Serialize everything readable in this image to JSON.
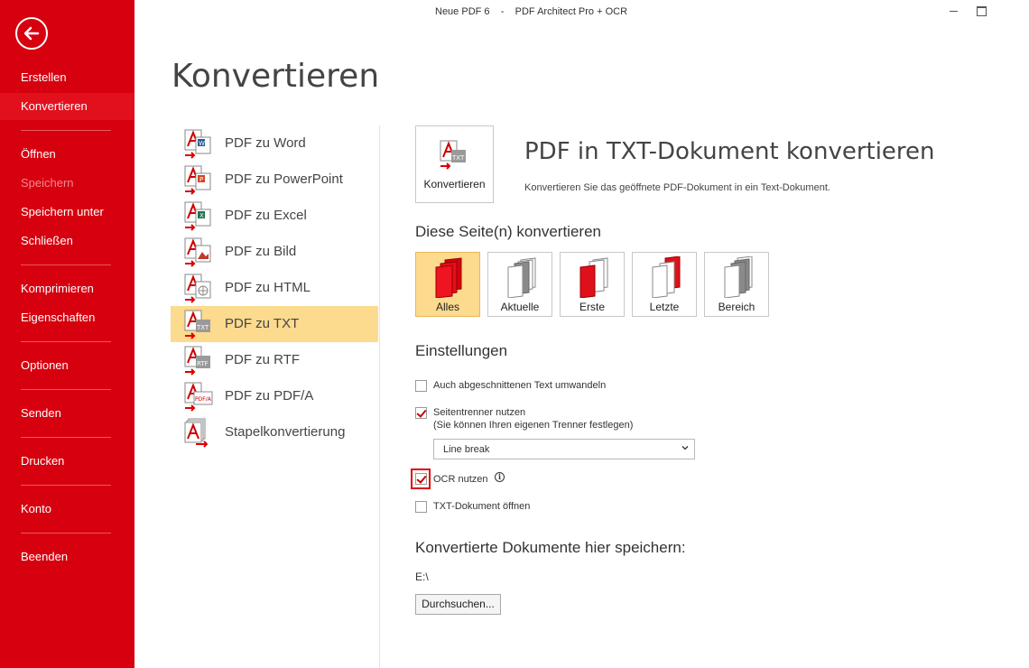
{
  "window": {
    "title": "Neue PDF 6    -    PDF Architect Pro + OCR"
  },
  "sidebar": {
    "back_icon": "arrow-left-circle-icon",
    "items": [
      {
        "label": "Erstellen"
      },
      {
        "label": "Konvertieren",
        "active": true
      },
      {
        "label": "Öffnen"
      },
      {
        "label": "Speichern",
        "disabled": true
      },
      {
        "label": "Speichern unter"
      },
      {
        "label": "Schließen"
      },
      {
        "label": "Komprimieren"
      },
      {
        "label": "Eigenschaften"
      },
      {
        "label": "Optionen"
      },
      {
        "label": "Senden"
      },
      {
        "label": "Drucken"
      },
      {
        "label": "Konto"
      },
      {
        "label": "Beenden"
      }
    ]
  },
  "page": {
    "title": "Konvertieren"
  },
  "formats": [
    {
      "label": "PDF zu Word",
      "icon": "pdf-to-word-icon"
    },
    {
      "label": "PDF zu PowerPoint",
      "icon": "pdf-to-powerpoint-icon"
    },
    {
      "label": "PDF zu Excel",
      "icon": "pdf-to-excel-icon"
    },
    {
      "label": "PDF zu Bild",
      "icon": "pdf-to-image-icon"
    },
    {
      "label": "PDF zu HTML",
      "icon": "pdf-to-html-icon"
    },
    {
      "label": "PDF zu TXT",
      "icon": "pdf-to-txt-icon",
      "selected": true
    },
    {
      "label": "PDF zu RTF",
      "icon": "pdf-to-rtf-icon"
    },
    {
      "label": "PDF zu PDF/A",
      "icon": "pdf-to-pdfa-icon"
    },
    {
      "label": "Stapelkonvertierung",
      "icon": "batch-convert-icon"
    }
  ],
  "panel": {
    "convert_button": "Konvertieren",
    "title": "PDF in TXT-Dokument konvertieren",
    "description": "Konvertieren Sie das geöffnete PDF-Dokument in ein Text-Dokument.",
    "pages_heading": "Diese Seite(n) konvertieren",
    "page_options": [
      {
        "label": "Alles",
        "selected": true
      },
      {
        "label": "Aktuelle"
      },
      {
        "label": "Erste"
      },
      {
        "label": "Letzte"
      },
      {
        "label": "Bereich"
      }
    ],
    "settings_heading": "Einstellungen",
    "settings": {
      "cut_text": {
        "label": "Auch abgeschnittenen Text umwandeln",
        "checked": false
      },
      "page_separator": {
        "label": "Seitentrenner nutzen",
        "sublabel": "(Sie können Ihren eigenen Trenner festlegen)",
        "checked": true
      },
      "separator_value": "Line break",
      "ocr": {
        "label": "OCR nutzen",
        "checked": true
      },
      "open_txt": {
        "label": "TXT-Dokument öffnen",
        "checked": false
      }
    },
    "save_heading": "Konvertierte Dokumente hier speichern:",
    "save_path": "E:\\",
    "browse_button": "Durchsuchen..."
  },
  "colors": {
    "sidebar": "#d7000f",
    "selection": "#fcda8e",
    "accent_red": "#e00000"
  }
}
